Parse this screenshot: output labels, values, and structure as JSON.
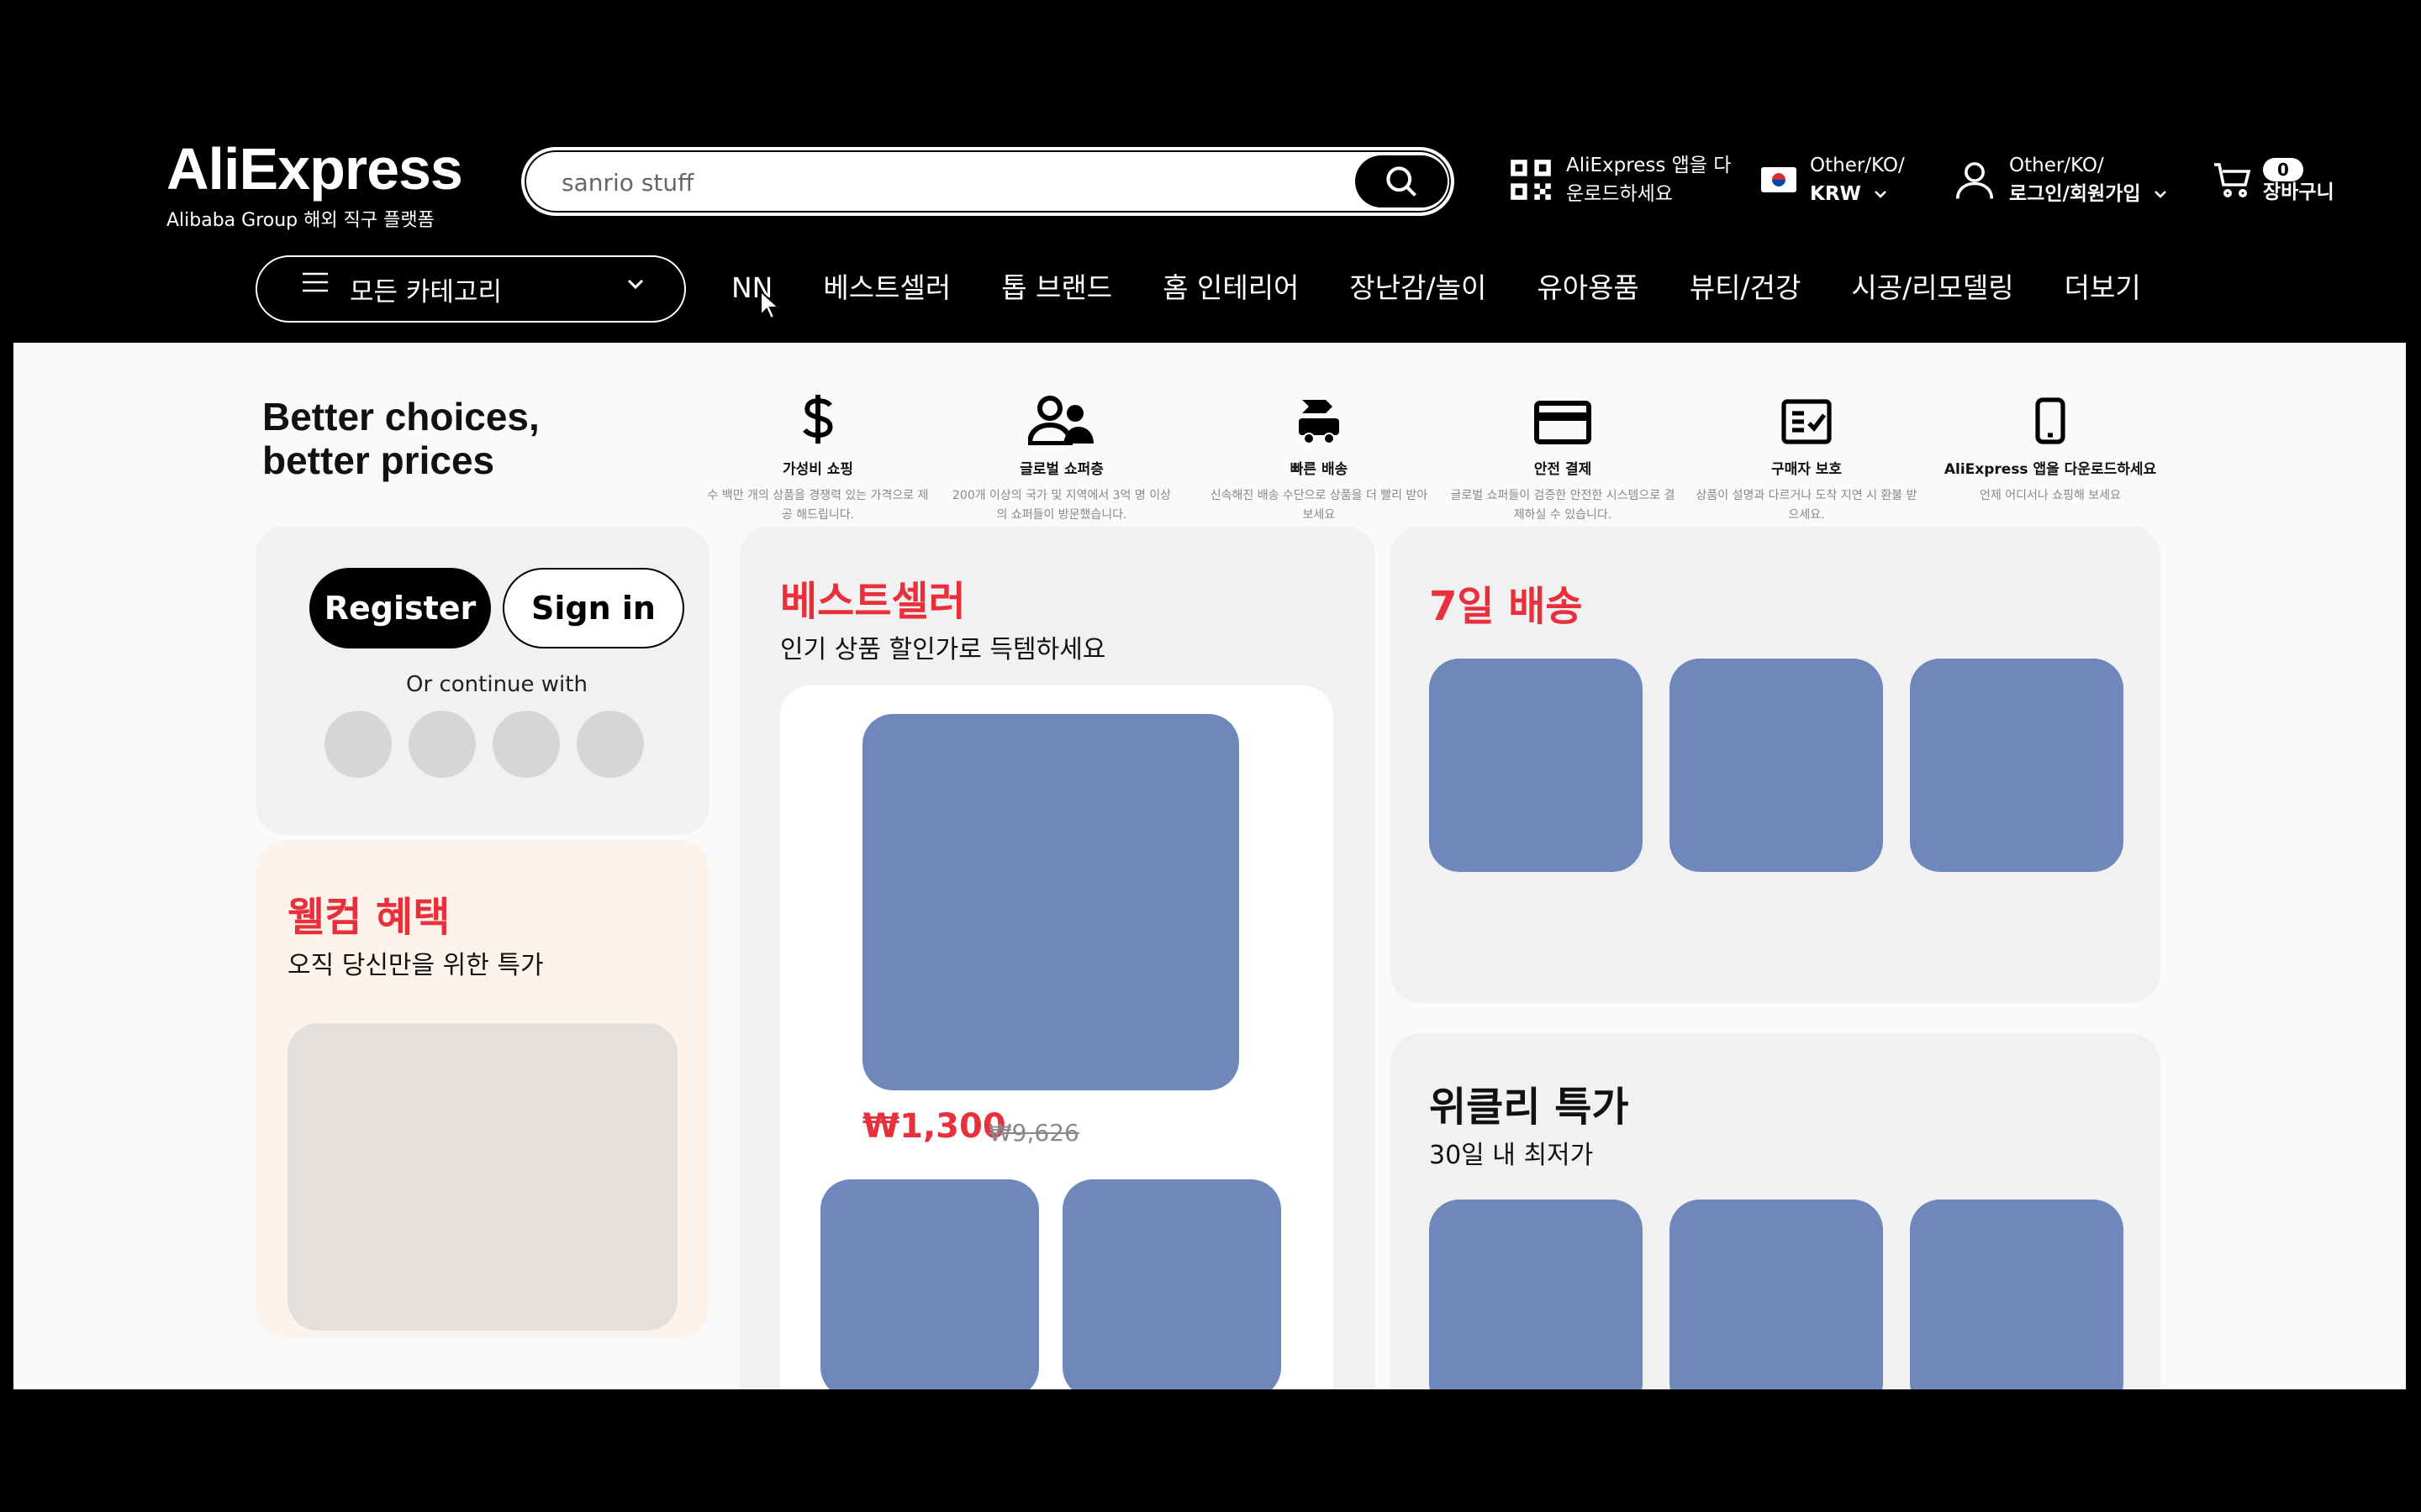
{
  "header": {
    "logo_title": "AliExpress",
    "logo_subtitle": "Alibaba Group 해외 직구 플랫폼",
    "search_placeholder": "sanrio stuff",
    "app_download_line1": "AliExpress 앱을 다",
    "app_download_line2": "운로드하세요",
    "region_line1": "Other/KO/",
    "region_line2": "KRW",
    "account_line1": "Other/KO/",
    "account_line2": "로그인/회원가입",
    "cart_count": "0",
    "cart_label": "장바구니"
  },
  "nav": {
    "all_categories": "모든 카테고리",
    "items": [
      "NN",
      "베스트셀러",
      "톱 브랜드",
      "홈 인테리어",
      "장난감/놀이",
      "유아용품",
      "뷰티/건강",
      "시공/리모델링",
      "더보기"
    ]
  },
  "promo": {
    "title_line1": "Better choices,",
    "title_line2": "better prices",
    "features": [
      {
        "icon": "dollar-icon",
        "title": "가성비 쇼핑",
        "desc": "수 백만 개의 상품을 경쟁력 있는 가격으로 제공 해드립니다."
      },
      {
        "icon": "users-icon",
        "title": "글로벌 쇼퍼층",
        "desc": "200개 이상의 국가 및 지역에서 3억 명 이상의 쇼퍼들이 방문했습니다."
      },
      {
        "icon": "delivery-truck-icon",
        "title": "빠른 배송",
        "desc": "신속해진 배송 수단으로 상품을 더 빨리 받아보세요"
      },
      {
        "icon": "credit-card-icon",
        "title": "안전 결제",
        "desc": "글로벌 쇼퍼들이 검증한 안전한 시스템으로 결제하실 수 있습니다."
      },
      {
        "icon": "checklist-icon",
        "title": "구매자 보호",
        "desc": "상품이 설명과 다르거나 도착 지연 시 환불 받으세요."
      },
      {
        "icon": "smartphone-icon",
        "title": "AliExpress 앱을 다운로드하세요",
        "desc": "언제 어디서나 쇼핑해 보세요"
      }
    ]
  },
  "auth": {
    "register": "Register",
    "sign_in": "Sign in",
    "or_continue": "Or continue with"
  },
  "welcome": {
    "title": "웰컴 혜택",
    "subtitle": "오직 당신만을 위한 특가"
  },
  "bestseller": {
    "title": "베스트셀러",
    "subtitle": "인기 상품 할인가로 득템하세요",
    "price": "₩1,300",
    "old_price": "₩9,626"
  },
  "delivery": {
    "title": "7일 배송"
  },
  "weekly": {
    "title": "위클리 특가",
    "subtitle": "30일 내 최저가"
  },
  "colors": {
    "accent_red": "#e8303c",
    "placeholder_blue": "#6f87bb"
  }
}
